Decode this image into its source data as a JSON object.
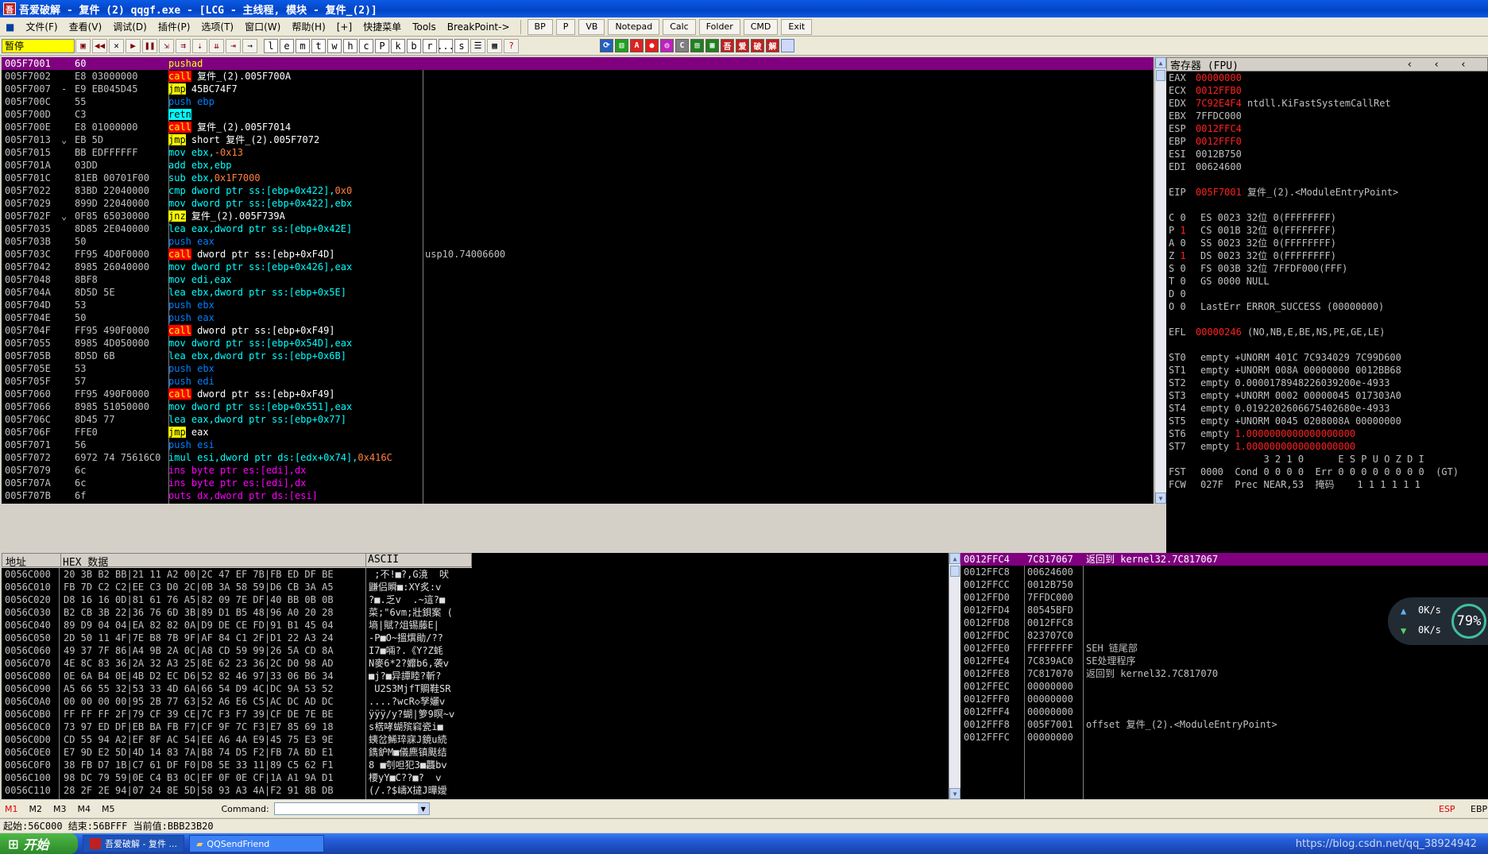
{
  "window": {
    "title": "吾爱破解 - 复件 (2) qqgf.exe - [LCG - 主线程, 模块 - 复件_(2)]"
  },
  "menu": {
    "items": [
      "文件(F)",
      "查看(V)",
      "调试(D)",
      "插件(P)",
      "选项(T)",
      "窗口(W)",
      "帮助(H)",
      "[+]",
      "快捷菜单",
      "Tools",
      "BreakPoint->"
    ],
    "tools": [
      "BP",
      "P",
      "VB",
      "Notepad",
      "Calc",
      "Folder",
      "CMD",
      "Exit"
    ]
  },
  "toolbar": {
    "status": "暂停",
    "letters": [
      "l",
      "e",
      "m",
      "t",
      "w",
      "h",
      "c",
      "P",
      "k",
      "b",
      "r",
      "...",
      "s"
    ]
  },
  "cpu": {
    "rows": [
      {
        "addr": "005F7001",
        "mark": "",
        "hex": "60",
        "kind": "",
        "op": "pushad",
        "args": "",
        "com": "",
        "hl": true
      },
      {
        "addr": "005F7002",
        "mark": "",
        "hex": "E8 03000000",
        "kind": "call",
        "op": "call",
        "args": " 复件_(2).005F700A",
        "com": ""
      },
      {
        "addr": "005F7007",
        "mark": "-",
        "hex": "E9 EB045D45",
        "kind": "jmp",
        "op": "jmp",
        "args": " 45BC74F7",
        "com": ""
      },
      {
        "addr": "005F700C",
        "mark": "",
        "hex": "55",
        "kind": "push",
        "op": "push ebp",
        "args": "",
        "com": ""
      },
      {
        "addr": "005F700D",
        "mark": "",
        "hex": "C3",
        "kind": "retn",
        "op": "retn",
        "args": "",
        "com": ""
      },
      {
        "addr": "005F700E",
        "mark": "",
        "hex": "E8 01000000",
        "kind": "call",
        "op": "call",
        "args": " 复件_(2).005F7014",
        "com": ""
      },
      {
        "addr": "005F7013",
        "mark": "⌄",
        "hex": "EB 5D",
        "kind": "jmp",
        "op": "jmp",
        "args": " short 复件_(2).005F7072",
        "com": ""
      },
      {
        "addr": "005F7015",
        "mark": "",
        "hex": "BB EDFFFFFF",
        "kind": "mov",
        "op": "mov ebx,",
        "args": "-0x13",
        "com": ""
      },
      {
        "addr": "005F701A",
        "mark": "",
        "hex": "03DD",
        "kind": "mov",
        "op": "add ebx,ebp",
        "args": "",
        "com": ""
      },
      {
        "addr": "005F701C",
        "mark": "",
        "hex": "81EB 00701F00",
        "kind": "mov",
        "op": "sub ebx,",
        "args": "0x1F7000",
        "com": ""
      },
      {
        "addr": "005F7022",
        "mark": "",
        "hex": "83BD 22040000",
        "kind": "mov",
        "op": "cmp dword ptr ss:[ebp+0x422],",
        "args": "0x0",
        "com": ""
      },
      {
        "addr": "005F7029",
        "mark": "",
        "hex": "899D 22040000",
        "kind": "mov",
        "op": "mov dword ptr ss:[ebp+0x422],ebx",
        "args": "",
        "com": ""
      },
      {
        "addr": "005F702F",
        "mark": "⌄",
        "hex": "0F85 65030000",
        "kind": "jmp",
        "op": "jnz",
        "args": " 复件_(2).005F739A",
        "com": ""
      },
      {
        "addr": "005F7035",
        "mark": "",
        "hex": "8D85 2E040000",
        "kind": "mov",
        "op": "lea eax,dword ptr ss:[ebp+0x42E]",
        "args": "",
        "com": ""
      },
      {
        "addr": "005F703B",
        "mark": "",
        "hex": "50",
        "kind": "push",
        "op": "push eax",
        "args": "",
        "com": ""
      },
      {
        "addr": "005F703C",
        "mark": "",
        "hex": "FF95 4D0F0000",
        "kind": "call",
        "op": "call",
        "args": " dword ptr ss:[ebp+0xF4D]",
        "com": "usp10.74006600"
      },
      {
        "addr": "005F7042",
        "mark": "",
        "hex": "8985 26040000",
        "kind": "mov",
        "op": "mov dword ptr ss:[ebp+0x426],eax",
        "args": "",
        "com": ""
      },
      {
        "addr": "005F7048",
        "mark": "",
        "hex": "8BF8",
        "kind": "mov",
        "op": "mov edi,eax",
        "args": "",
        "com": ""
      },
      {
        "addr": "005F704A",
        "mark": "",
        "hex": "8D5D 5E",
        "kind": "mov",
        "op": "lea ebx,dword ptr ss:[ebp+0x5E]",
        "args": "",
        "com": ""
      },
      {
        "addr": "005F704D",
        "mark": "",
        "hex": "53",
        "kind": "push",
        "op": "push ebx",
        "args": "",
        "com": ""
      },
      {
        "addr": "005F704E",
        "mark": "",
        "hex": "50",
        "kind": "push",
        "op": "push eax",
        "args": "",
        "com": ""
      },
      {
        "addr": "005F704F",
        "mark": "",
        "hex": "FF95 490F0000",
        "kind": "call",
        "op": "call",
        "args": " dword ptr ss:[ebp+0xF49]",
        "com": ""
      },
      {
        "addr": "005F7055",
        "mark": "",
        "hex": "8985 4D050000",
        "kind": "mov",
        "op": "mov dword ptr ss:[ebp+0x54D],eax",
        "args": "",
        "com": ""
      },
      {
        "addr": "005F705B",
        "mark": "",
        "hex": "8D5D 6B",
        "kind": "mov",
        "op": "lea ebx,dword ptr ss:[ebp+0x6B]",
        "args": "",
        "com": ""
      },
      {
        "addr": "005F705E",
        "mark": "",
        "hex": "53",
        "kind": "push",
        "op": "push ebx",
        "args": "",
        "com": ""
      },
      {
        "addr": "005F705F",
        "mark": "",
        "hex": "57",
        "kind": "push",
        "op": "push edi",
        "args": "",
        "com": ""
      },
      {
        "addr": "005F7060",
        "mark": "",
        "hex": "FF95 490F0000",
        "kind": "call",
        "op": "call",
        "args": " dword ptr ss:[ebp+0xF49]",
        "com": ""
      },
      {
        "addr": "005F7066",
        "mark": "",
        "hex": "8985 51050000",
        "kind": "mov",
        "op": "mov dword ptr ss:[ebp+0x551],eax",
        "args": "",
        "com": ""
      },
      {
        "addr": "005F706C",
        "mark": "",
        "hex": "8D45 77",
        "kind": "mov",
        "op": "lea eax,dword ptr ss:[ebp+0x77]",
        "args": "",
        "com": ""
      },
      {
        "addr": "005F706F",
        "mark": "",
        "hex": "FFE0",
        "kind": "jmp",
        "op": "jmp",
        "args": " eax",
        "com": ""
      },
      {
        "addr": "005F7071",
        "mark": "",
        "hex": "56",
        "kind": "push",
        "op": "push esi",
        "args": "",
        "com": ""
      },
      {
        "addr": "005F7072",
        "mark": "",
        "hex": "6972 74 75616C0",
        "kind": "mov",
        "op": "imul esi,dword ptr ds:[edx+0x74],",
        "args": "0x416C",
        "com": ""
      },
      {
        "addr": "005F7079",
        "mark": "",
        "hex": "6c",
        "kind": "int",
        "op": "ins byte ptr es:[edi],dx",
        "args": "",
        "com": ""
      },
      {
        "addr": "005F707A",
        "mark": "",
        "hex": "6c",
        "kind": "int",
        "op": "ins byte ptr es:[edi],dx",
        "args": "",
        "com": ""
      },
      {
        "addr": "005F707B",
        "mark": "",
        "hex": "6f",
        "kind": "int",
        "op": "outs dx,dword ptr ds:[esi]",
        "args": "",
        "com": ""
      }
    ]
  },
  "regs": {
    "title": "寄存器 (FPU)",
    "lines": [
      {
        "n": "EAX",
        "v": "00000000",
        "red": true,
        "c": ""
      },
      {
        "n": "ECX",
        "v": "0012FFB0",
        "red": true,
        "c": ""
      },
      {
        "n": "EDX",
        "v": "7C92E4F4",
        "red": true,
        "c": " ntdll.KiFastSystemCallRet"
      },
      {
        "n": "EBX",
        "v": "7FFDC000",
        "red": false,
        "c": ""
      },
      {
        "n": "ESP",
        "v": "0012FFC4",
        "red": true,
        "c": ""
      },
      {
        "n": "EBP",
        "v": "0012FFF0",
        "red": true,
        "c": ""
      },
      {
        "n": "ESI",
        "v": "0012B750",
        "red": false,
        "c": ""
      },
      {
        "n": "EDI",
        "v": "00624600",
        "red": false,
        "c": ""
      },
      {
        "n": "",
        "v": "",
        "red": false,
        "c": ""
      },
      {
        "n": "EIP",
        "v": "005F7001",
        "red": true,
        "c": " 复件_(2).<ModuleEntryPoint>"
      },
      {
        "n": "",
        "v": "",
        "red": false,
        "c": ""
      },
      {
        "n": "C 0",
        "v": "",
        "red": false,
        "c": "ES 0023 32位 0(FFFFFFFF)"
      },
      {
        "n": "P 1",
        "v": "",
        "red": true,
        "c": "CS 001B 32位 0(FFFFFFFF)"
      },
      {
        "n": "A 0",
        "v": "",
        "red": false,
        "c": "SS 0023 32位 0(FFFFFFFF)"
      },
      {
        "n": "Z 1",
        "v": "",
        "red": true,
        "c": "DS 0023 32位 0(FFFFFFFF)"
      },
      {
        "n": "S 0",
        "v": "",
        "red": false,
        "c": "FS 003B 32位 7FFDF000(FFF)"
      },
      {
        "n": "T 0",
        "v": "",
        "red": false,
        "c": "GS 0000 NULL"
      },
      {
        "n": "D 0",
        "v": "",
        "red": false,
        "c": ""
      },
      {
        "n": "O 0",
        "v": "",
        "red": false,
        "c": "LastErr ERROR_SUCCESS (00000000)"
      },
      {
        "n": "",
        "v": "",
        "red": false,
        "c": ""
      },
      {
        "n": "EFL",
        "v": "00000246",
        "red": true,
        "c": " (NO,NB,E,BE,NS,PE,GE,LE)"
      },
      {
        "n": "",
        "v": "",
        "red": false,
        "c": ""
      },
      {
        "n": "ST0",
        "v": "",
        "red": false,
        "c": "empty +UNORM 401C 7C934029 7C99D600"
      },
      {
        "n": "ST1",
        "v": "",
        "red": false,
        "c": "empty +UNORM 008A 00000000 0012BB68"
      },
      {
        "n": "ST2",
        "v": "",
        "red": false,
        "c": "empty 0.0000178948226039200e-4933"
      },
      {
        "n": "ST3",
        "v": "",
        "red": false,
        "c": "empty +UNORM 0002 00000045 017303A0"
      },
      {
        "n": "ST4",
        "v": "",
        "red": false,
        "c": "empty 0.0192202606675402680e-4933"
      },
      {
        "n": "ST5",
        "v": "",
        "red": false,
        "c": "empty +UNORM 0045 0208008A 00000000"
      },
      {
        "n": "ST6",
        "v": "",
        "red": false,
        "c": "empty ",
        "r2": "1.0000000000000000000"
      },
      {
        "n": "ST7",
        "v": "",
        "red": false,
        "c": "empty ",
        "r2": "1.0000000000000000000"
      },
      {
        "n": "",
        "v": "",
        "red": false,
        "c": "           3 2 1 0      E S P U O Z D I"
      },
      {
        "n": "FST",
        "v": "",
        "red": false,
        "c": "0000  Cond 0 0 0 0  Err 0 0 0 0 0 0 0 0  (GT)"
      },
      {
        "n": "FCW",
        "v": "",
        "red": false,
        "c": "027F  Prec NEAR,53  掩码    1 1 1 1 1 1"
      }
    ]
  },
  "dump": {
    "header": {
      "addr": "地址",
      "hex": "HEX 数据",
      "ascii": "ASCII"
    },
    "rows": [
      {
        "a": "0056C000",
        "h": "20 3B B2 BB|21 11 A2 00|2C 47 EF 7B|FB ED DF BE",
        "s": " ;不!■?,G滰  吠"
      },
      {
        "a": "0056C010",
        "h": "FB 7D C2 C2|EE C3 D0 2C|0B 3A 58 59|D6 CB 3A A5",
        "s": "鼸侣瞬■:XY炙:ⅴ"
      },
      {
        "a": "0056C020",
        "h": "D8 16 16 0D|81 61 76 A5|82 09 7E DF|40 BB 0B 0B",
        "s": "?■.乏v  .~這?■"
      },
      {
        "a": "0056C030",
        "h": "B2 CB 3B 22|36 76 6D 3B|89 D1 B5 48|96 A0 20 28",
        "s": "菜;\"6vm;壯鋇案 ("
      },
      {
        "a": "0056C040",
        "h": "89 D9 04 04|EA 82 82 0A|D9 DE CE FD|91 B1 45 04",
        "s": "墒|賦?俎锡藤E|"
      },
      {
        "a": "0056C050",
        "h": "2D 50 11 4F|7E B8 7B 9F|AF 84 C1 2F|D1 22 A3 24",
        "s": "-P■O~搵熼勛/??"
      },
      {
        "a": "0056C060",
        "h": "49 37 7F 86|A4 9B 2A 0C|A8 CD 59 99|26 5A CD 8A",
        "s": "I7■啢?.《Y?Z蚝"
      },
      {
        "a": "0056C070",
        "h": "4E 8C 83 36|2A 32 A3 25|8E 62 23 36|2C D0 98 AD",
        "s": "N麥6*2?孊b6,袭ⅴ"
      },
      {
        "a": "0056C080",
        "h": "0E 6A B4 0E|4B D2 EC D6|52 82 46 97|33 06 B6 34",
        "s": "■j?■异譚睦?斬?"
      },
      {
        "a": "0056C090",
        "h": "A5 66 55 32|53 33 4D 6A|66 54 D9 4C|DC 9A 53 52",
        "s": " U2S3MjfT賙鞋SR"
      },
      {
        "a": "0056C0A0",
        "h": "00 00 00 00|95 2B 77 63|52 A6 E6 C5|AC DC AD DC",
        "s": "....?wcR◇孥孋ⅴ"
      },
      {
        "a": "0056C0B0",
        "h": "FF FF FF 2F|79 CF 39 CE|7C F3 F7 39|CF DE 7E BE",
        "s": "ÿÿÿ/y?蝴|箩9瞑~ⅴ"
      },
      {
        "a": "0056C0C0",
        "h": "73 97 ED DF|EB BA FB F7|CF 9F 7C F3|E7 85 69 18",
        "s": "s楛哮蝴殡窲瓷i■"
      },
      {
        "a": "0056C0D0",
        "h": "CD 55 94 A2|EF 8F AC 54|EE A6 4A E9|45 75 E3 9E",
        "s": "蛦岔鯑琗寐J鏡u続"
      },
      {
        "a": "0056C0E0",
        "h": "E7 9D E2 5D|4D 14 83 7A|B8 74 D5 F2|FB 7A BD E1",
        "s": "鐫鈩M■儀麃镇颫结"
      },
      {
        "a": "0056C0F0",
        "h": "38 FB D7 1B|C7 61 DF F0|D8 5E 33 11|89 C5 62 F1",
        "s": "8 ■刳呾犯3■龘bⅴ"
      },
      {
        "a": "0056C100",
        "h": "98 DC 79 59|0E C4 B3 0C|EF 0F 0E CF|1A A1 9A D1",
        "s": "楆yY■C??■?  ⅴ"
      },
      {
        "a": "0056C110",
        "h": "28 2F 2E 94|07 24 8E 5D|58 93 A3 4A|F2 91 8B DB",
        "s": "(/.?$嶹X撻J曄嬡"
      }
    ]
  },
  "stack": {
    "rows": [
      {
        "a": "0012FFC4",
        "v": "7C817067",
        "c": "返回到 kernel32.7C817067",
        "hl": true
      },
      {
        "a": "0012FFC8",
        "v": "00624600",
        "c": ""
      },
      {
        "a": "0012FFCC",
        "v": "0012B750",
        "c": ""
      },
      {
        "a": "0012FFD0",
        "v": "7FFDC000",
        "c": ""
      },
      {
        "a": "0012FFD4",
        "v": "80545BFD",
        "c": ""
      },
      {
        "a": "0012FFD8",
        "v": "0012FFC8",
        "c": ""
      },
      {
        "a": "0012FFDC",
        "v": "823707C0",
        "c": ""
      },
      {
        "a": "0012FFE0",
        "v": "FFFFFFFF",
        "c": "SEH 链尾部"
      },
      {
        "a": "0012FFE4",
        "v": "7C839AC0",
        "c": "SE处理程序"
      },
      {
        "a": "0012FFE8",
        "v": "7C817070",
        "c": "返回到 kernel32.7C817070"
      },
      {
        "a": "0012FFEC",
        "v": "00000000",
        "c": ""
      },
      {
        "a": "0012FFF0",
        "v": "00000000",
        "c": ""
      },
      {
        "a": "0012FFF4",
        "v": "00000000",
        "c": ""
      },
      {
        "a": "0012FFF8",
        "v": "005F7001",
        "c": "offset 复件_(2).<ModuleEntryPoint>"
      },
      {
        "a": "0012FFFC",
        "v": "00000000",
        "c": ""
      }
    ],
    "net": {
      "up": "0K/s",
      "down": "0K/s",
      "pct": "79"
    }
  },
  "bottom": {
    "tabs": [
      "M1",
      "M2",
      "M3",
      "M4",
      "M5"
    ],
    "command_label": "Command:",
    "command_value": "",
    "esp": "ESP",
    "ebp": "EBP",
    "info": "起始:56C000 结束:56BFFF 当前值:BBB23B20"
  },
  "taskbar": {
    "start": "开始",
    "tasks": [
      "吾爱破解 - 复件 ...",
      "QQSendFriend"
    ],
    "watermark": "https://blog.csdn.net/qq_38924942"
  }
}
